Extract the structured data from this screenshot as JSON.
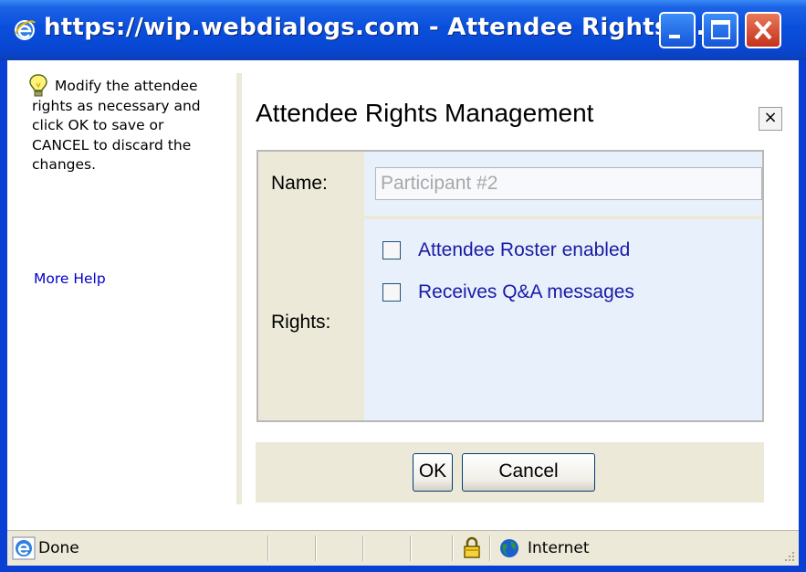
{
  "window": {
    "title": "https://wip.webdialogs.com - Attendee Rights ...",
    "controls": {
      "minimize": "minimize",
      "maximize": "maximize",
      "close": "close"
    }
  },
  "sidebar": {
    "help_line1": "Modify the",
    "help_rest": "attendee rights as necessary and click OK to save or CANCEL to discard the changes.",
    "more_help": "More Help"
  },
  "dialog": {
    "title": "Attendee Rights Management",
    "close_glyph": "×",
    "name_label": "Name:",
    "name_placeholder": "Participant #2",
    "rights_label": "Rights:",
    "rights": [
      {
        "label": "Attendee Roster enabled",
        "checked": false
      },
      {
        "label": "Receives Q&A messages",
        "checked": false
      }
    ],
    "ok_label": "OK",
    "cancel_label": "Cancel"
  },
  "statusbar": {
    "status": "Done",
    "zone": "Internet"
  },
  "icons": {
    "title": "ie-icon",
    "hint": "lightbulb-icon",
    "status": "ie-icon",
    "security": "lock-icon",
    "zone": "globe-icon"
  },
  "colors": {
    "titlebar": "#0a4fdc",
    "link": "#0000cc",
    "checkbox_label": "#1a1aa6",
    "panel": "#ece9d8",
    "field_bg": "#e8f1fb",
    "close_button": "#c5321a"
  }
}
